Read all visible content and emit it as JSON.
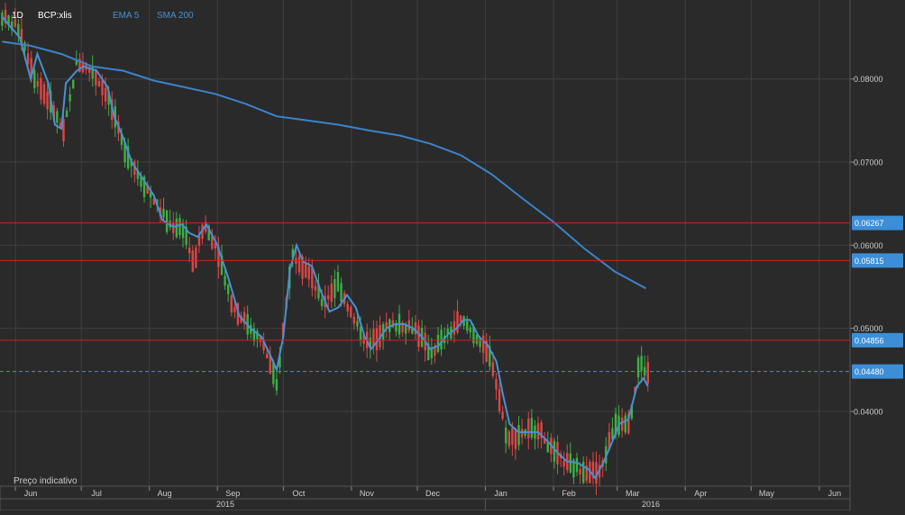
{
  "header": {
    "timeframe": "1D",
    "symbol": "BCP:xlis",
    "ema_label": "EMA 5",
    "sma_label": "SMA 200"
  },
  "footnote": "Preço indicativo",
  "colors": {
    "background": "#2a2a2a",
    "grid": "#3f3f3f",
    "up": "#3cb043",
    "down": "#e04545",
    "ema": "#4a90d0",
    "sma": "#3a84cc",
    "level_line": "#d42020",
    "level_badge": "#3c8ed8",
    "last_price_line": "#4a90d0"
  },
  "chart_data": {
    "type": "candlestick",
    "title": "",
    "symbol": "BCP:xlis",
    "timeframe": "1D",
    "ylim": [
      0.031,
      0.0895
    ],
    "y_ticks": [
      "0.08000",
      "0.07000",
      "0.06000",
      "0.05000",
      "0.04000"
    ],
    "x_ticks": [
      "Jun",
      "Jul",
      "Aug",
      "Sep",
      "Oct",
      "Nov",
      "Dec",
      "Jan",
      "Feb",
      "Mar",
      "Apr",
      "May",
      "Jun"
    ],
    "year_labels": [
      "2015",
      "2016"
    ],
    "grid": true,
    "horizontal_levels": [
      "0.06267",
      "0.05815",
      "0.04856"
    ],
    "last_price": "0.04480",
    "series": [
      {
        "name": "EMA 5",
        "type": "line",
        "points": [
          [
            "2015-05-26",
            0.0875
          ],
          [
            "2015-05-29",
            0.0865
          ],
          [
            "2015-06-03",
            0.085
          ],
          [
            "2015-06-08",
            0.08
          ],
          [
            "2015-06-11",
            0.083
          ],
          [
            "2015-06-16",
            0.0795
          ],
          [
            "2015-06-19",
            0.0745
          ],
          [
            "2015-06-22",
            0.074
          ],
          [
            "2015-06-24",
            0.0795
          ],
          [
            "2015-06-29",
            0.081
          ],
          [
            "2015-07-02",
            0.0815
          ],
          [
            "2015-07-08",
            0.081
          ],
          [
            "2015-07-13",
            0.079
          ],
          [
            "2015-07-16",
            0.0755
          ],
          [
            "2015-07-20",
            0.073
          ],
          [
            "2015-07-24",
            0.07
          ],
          [
            "2015-07-29",
            0.068
          ],
          [
            "2015-08-03",
            0.066
          ],
          [
            "2015-08-07",
            0.063
          ],
          [
            "2015-08-12",
            0.0622
          ],
          [
            "2015-08-16",
            0.0625
          ],
          [
            "2015-08-19",
            0.0615
          ],
          [
            "2015-08-23",
            0.061
          ],
          [
            "2015-08-27",
            0.0625
          ],
          [
            "2015-09-01",
            0.06
          ],
          [
            "2015-09-06",
            0.056
          ],
          [
            "2015-09-11",
            0.0515
          ],
          [
            "2015-09-16",
            0.05
          ],
          [
            "2015-09-21",
            0.049
          ],
          [
            "2015-09-25",
            0.0468
          ],
          [
            "2015-09-28",
            0.045
          ],
          [
            "2015-10-01",
            0.049
          ],
          [
            "2015-10-04",
            0.057
          ],
          [
            "2015-10-07",
            0.06
          ],
          [
            "2015-10-10",
            0.058
          ],
          [
            "2015-10-14",
            0.0575
          ],
          [
            "2015-10-18",
            0.0545
          ],
          [
            "2015-10-22",
            0.052
          ],
          [
            "2015-10-26",
            0.0525
          ],
          [
            "2015-10-30",
            0.054
          ],
          [
            "2015-11-03",
            0.0525
          ],
          [
            "2015-11-07",
            0.049
          ],
          [
            "2015-11-10",
            0.0475
          ],
          [
            "2015-11-13",
            0.0485
          ],
          [
            "2015-11-17",
            0.05
          ],
          [
            "2015-11-21",
            0.0505
          ],
          [
            "2015-11-25",
            0.0505
          ],
          [
            "2015-11-29",
            0.05
          ],
          [
            "2015-12-03",
            0.049
          ],
          [
            "2015-12-07",
            0.0475
          ],
          [
            "2015-12-11",
            0.048
          ],
          [
            "2015-12-15",
            0.0493
          ],
          [
            "2015-12-19",
            0.05
          ],
          [
            "2015-12-22",
            0.051
          ],
          [
            "2015-12-25",
            0.051
          ],
          [
            "2015-12-29",
            0.049
          ],
          [
            "2016-01-02",
            0.048
          ],
          [
            "2016-01-06",
            0.046
          ],
          [
            "2016-01-09",
            0.042
          ],
          [
            "2016-01-12",
            0.0385
          ],
          [
            "2016-01-16",
            0.0375
          ],
          [
            "2016-01-21",
            0.0375
          ],
          [
            "2016-01-25",
            0.0375
          ],
          [
            "2016-01-29",
            0.0365
          ],
          [
            "2016-02-03",
            0.035
          ],
          [
            "2016-02-07",
            0.034
          ],
          [
            "2016-02-12",
            0.0338
          ],
          [
            "2016-02-17",
            0.033
          ],
          [
            "2016-02-20",
            0.032
          ],
          [
            "2016-02-24",
            0.034
          ],
          [
            "2016-02-28",
            0.0365
          ],
          [
            "2016-03-02",
            0.0385
          ],
          [
            "2016-03-06",
            0.039
          ],
          [
            "2016-03-10",
            0.043
          ],
          [
            "2016-03-13",
            0.044
          ],
          [
            "2016-03-15",
            0.043
          ]
        ]
      },
      {
        "name": "SMA 200",
        "type": "line",
        "points": [
          [
            "2015-05-26",
            0.0845
          ],
          [
            "2015-06-08",
            0.084
          ],
          [
            "2015-06-22",
            0.083
          ],
          [
            "2015-07-06",
            0.0815
          ],
          [
            "2015-07-20",
            0.081
          ],
          [
            "2015-08-03",
            0.0798
          ],
          [
            "2015-08-17",
            0.079
          ],
          [
            "2015-08-31",
            0.0782
          ],
          [
            "2015-09-14",
            0.077
          ],
          [
            "2015-09-28",
            0.0755
          ],
          [
            "2015-10-12",
            0.075
          ],
          [
            "2015-10-26",
            0.0745
          ],
          [
            "2015-11-09",
            0.0738
          ],
          [
            "2015-11-23",
            0.0732
          ],
          [
            "2015-12-07",
            0.0722
          ],
          [
            "2015-12-21",
            0.0708
          ],
          [
            "2016-01-04",
            0.0685
          ],
          [
            "2016-01-18",
            0.0656
          ],
          [
            "2016-02-01",
            0.0628
          ],
          [
            "2016-02-15",
            0.0596
          ],
          [
            "2016-02-29",
            0.0568
          ],
          [
            "2016-03-14",
            0.0548
          ]
        ]
      }
    ],
    "candle_anchors": [
      [
        "2015-05-26",
        0.0875
      ],
      [
        "2015-06-03",
        0.086
      ],
      [
        "2015-06-10",
        0.08
      ],
      [
        "2015-06-17",
        0.077
      ],
      [
        "2015-06-23",
        0.0735
      ],
      [
        "2015-06-29",
        0.082
      ],
      [
        "2015-07-06",
        0.081
      ],
      [
        "2015-07-13",
        0.078
      ],
      [
        "2015-07-20",
        0.072
      ],
      [
        "2015-07-27",
        0.0685
      ],
      [
        "2015-08-03",
        0.0655
      ],
      [
        "2015-08-10",
        0.0625
      ],
      [
        "2015-08-17",
        0.062
      ],
      [
        "2015-08-21",
        0.0575
      ],
      [
        "2015-08-26",
        0.0625
      ],
      [
        "2015-09-01",
        0.0595
      ],
      [
        "2015-09-08",
        0.0525
      ],
      [
        "2015-09-15",
        0.0505
      ],
      [
        "2015-09-22",
        0.048
      ],
      [
        "2015-09-28",
        0.043
      ],
      [
        "2015-10-05",
        0.059
      ],
      [
        "2015-10-12",
        0.057
      ],
      [
        "2015-10-19",
        0.053
      ],
      [
        "2015-10-26",
        0.0555
      ],
      [
        "2015-11-02",
        0.051
      ],
      [
        "2015-11-09",
        0.048
      ],
      [
        "2015-11-16",
        0.05
      ],
      [
        "2015-11-23",
        0.0505
      ],
      [
        "2015-11-30",
        0.05
      ],
      [
        "2015-12-07",
        0.047
      ],
      [
        "2015-12-14",
        0.049
      ],
      [
        "2015-12-21",
        0.051
      ],
      [
        "2015-12-28",
        0.049
      ],
      [
        "2016-01-04",
        0.046
      ],
      [
        "2016-01-11",
        0.0365
      ],
      [
        "2016-01-18",
        0.0375
      ],
      [
        "2016-01-25",
        0.038
      ],
      [
        "2016-02-01",
        0.035
      ],
      [
        "2016-02-08",
        0.0335
      ],
      [
        "2016-02-15",
        0.033
      ],
      [
        "2016-02-22",
        0.0325
      ],
      [
        "2016-02-29",
        0.0385
      ],
      [
        "2016-03-07",
        0.039
      ],
      [
        "2016-03-11",
        0.046
      ],
      [
        "2016-03-15",
        0.0445
      ]
    ]
  }
}
